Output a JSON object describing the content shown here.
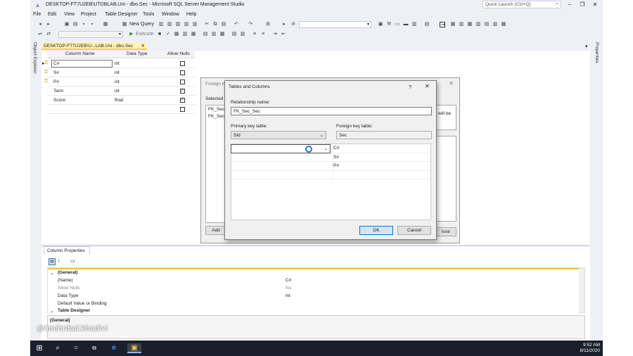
{
  "window": {
    "title": "DESKTOP-FT7U2EB\\UTDBLAB.Uni - dbo.Sec - Microsoft SQL Server Management Studio",
    "quick_launch": "Quick Launch (Ctrl+Q)"
  },
  "menu": [
    "File",
    "Edit",
    "View",
    "Project",
    "Table Designer",
    "Tools",
    "Window",
    "Help"
  ],
  "toolbar": {
    "new_query": "New Query",
    "execute": "Execute"
  },
  "side": {
    "object_explorer": "Object Explorer",
    "properties": "Properties"
  },
  "doc_tab": {
    "label": "DESKTOP-FT7U2EB\\U...LAB.Uni - dbo.Sec"
  },
  "designer": {
    "headers": {
      "column_name": "Column Name",
      "data_type": "Data Type",
      "allow_nulls": "Allow Nulls"
    },
    "rows": [
      {
        "name": "C#",
        "type": "int",
        "nulls": false,
        "key": true
      },
      {
        "name": "S#",
        "type": "int",
        "nulls": false,
        "key": true
      },
      {
        "name": "P#",
        "type": "int",
        "nulls": false,
        "key": true
      },
      {
        "name": "Term",
        "type": "int",
        "nulls": true,
        "key": false
      },
      {
        "name": "Score",
        "type": "float",
        "nulls": true,
        "key": false
      },
      {
        "name": "",
        "type": "",
        "nulls": false,
        "key": false
      }
    ]
  },
  "fk_dialog": {
    "title": "Foreign K",
    "selected": "Selected",
    "items": [
      "FK_Sec_",
      "FK_Sec_"
    ],
    "will_be": "will be",
    "add": "Add",
    "close": "lose"
  },
  "tc_dialog": {
    "title": "Tables and Columns",
    "help": "?",
    "close": "✕",
    "rel_label": "Relationship name:",
    "rel_value": "FK_Sec_Sec",
    "pk_label": "Primary key table:",
    "pk_value": "Std",
    "fk_label": "Foreign key table:",
    "fk_value": "Sec",
    "fk_columns": [
      "C#",
      "S#",
      "P#"
    ],
    "ok": "OK",
    "cancel": "Cancel"
  },
  "column_properties": {
    "tab": "Column Properties",
    "rows": [
      {
        "name": "(General)",
        "value": "",
        "category": true
      },
      {
        "name": "(Name)",
        "value": "C#"
      },
      {
        "name": "Allow Nulls",
        "value": "No",
        "grey": true
      },
      {
        "name": "Data Type",
        "value": "int"
      },
      {
        "name": "Default Value or Binding",
        "value": ""
      },
      {
        "name": "Table Designer",
        "value": "",
        "category": true
      }
    ],
    "description": "(General)"
  },
  "watermark": "@/mehrdad.khadivi",
  "taskbar": {
    "time": "9:52 AM",
    "date": "8/11/2020"
  }
}
